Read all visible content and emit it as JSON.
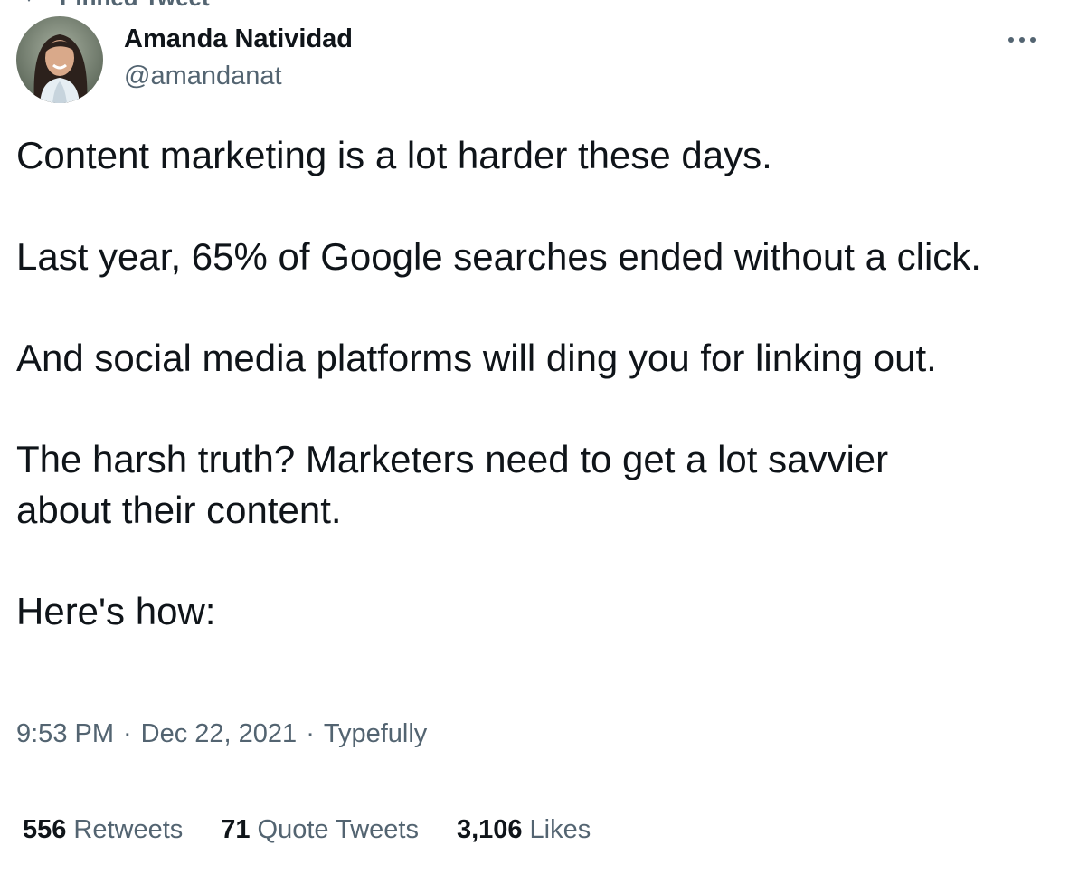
{
  "pinned": {
    "label": "Pinned Tweet",
    "icon": "pin-icon"
  },
  "author": {
    "display_name": "Amanda Natividad",
    "handle": "@amandanat",
    "avatar_icon": "avatar"
  },
  "more_icon": "more-dots-icon",
  "tweet": {
    "paragraphs": [
      "Content marketing is a lot harder these days.",
      "Last year, 65% of Google searches ended without a click.",
      "And social media platforms will ding you for linking out.",
      "The harsh truth? Marketers need to get a lot savvier about their content.",
      "Here's how:"
    ]
  },
  "meta": {
    "time": "9:53 PM",
    "separator": "·",
    "date": "Dec 22, 2021",
    "source": "Typefully"
  },
  "stats": {
    "retweets": {
      "count": "556",
      "label": "Retweets"
    },
    "quotes": {
      "count": "71",
      "label": "Quote Tweets"
    },
    "likes": {
      "count": "3,106",
      "label": "Likes"
    }
  },
  "colors": {
    "text": "#0f1419",
    "secondary": "#536471",
    "divider": "#eff3f4"
  }
}
